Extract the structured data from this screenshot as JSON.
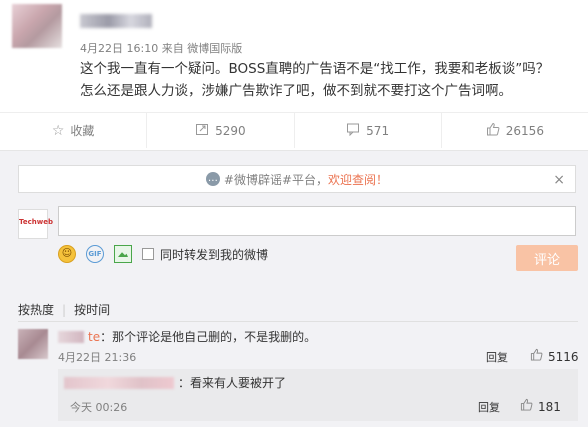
{
  "post": {
    "date": "4月22日 16:10",
    "source_prefix": "来自",
    "source": "微博国际版",
    "content_line1": "这个我一直有一个疑问。BOSS直聘的广告语不是“找工作，我要和老板谈”吗？",
    "content_line2": "怎么还是跟人力谈，涉嫌广告欺诈了吧，做不到就不要打这个广告词啊。"
  },
  "actions": {
    "favorite_label": "收藏",
    "repost_count": "5290",
    "comment_count": "571",
    "like_count": "26156"
  },
  "notice": {
    "prefix": "#微博辟谣#平台，",
    "link": "欢迎查阅！",
    "close": "×"
  },
  "composer": {
    "avatar_text": "Techweb",
    "also_repost_label": "同时转发到我的微博",
    "submit_label": "评论"
  },
  "sort": {
    "by_hot": "按热度",
    "by_time": "按时间"
  },
  "comments": [
    {
      "name_suffix": "te",
      "text": "：那个评论是他自己删的，不是我删的。",
      "time": "4月22日 21:36",
      "reply_label": "回复",
      "likes": "5116",
      "reply": {
        "text": "：看来有人要被开了",
        "time": "今天 00:26",
        "reply_label": "回复",
        "likes": "181"
      }
    }
  ],
  "icons": {
    "favorite": "star-icon",
    "repost": "repost-icon",
    "comment": "comment-icon",
    "like": "thumb-up-icon"
  },
  "colors": {
    "link_orange": "#eb7350",
    "submit_disabled": "#f9c3a5",
    "background_gray": "#f2f2f5"
  }
}
